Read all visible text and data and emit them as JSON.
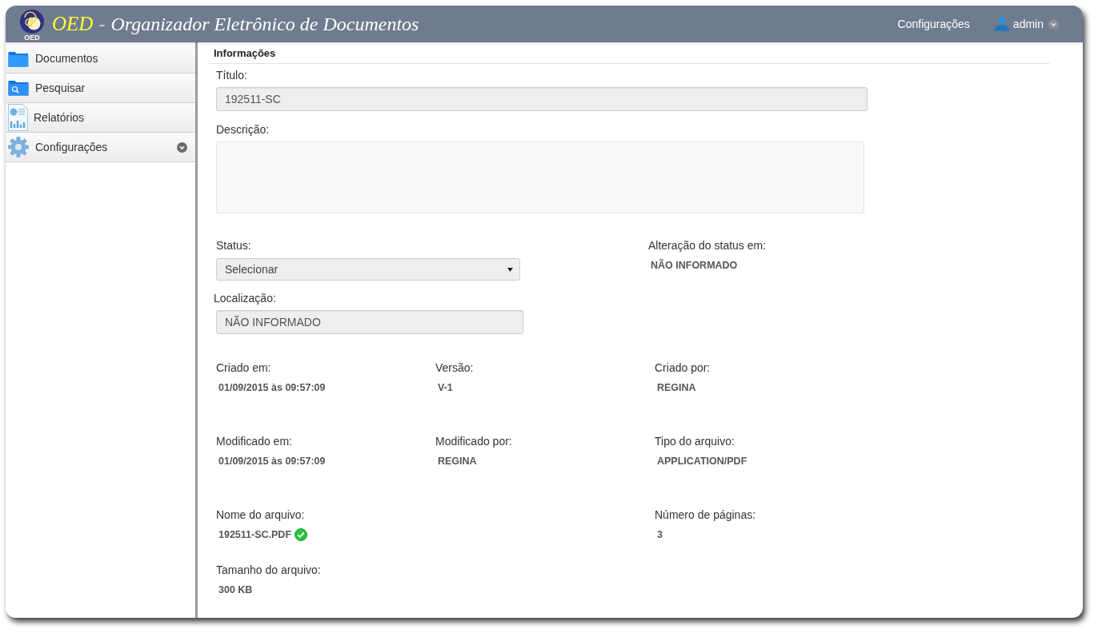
{
  "header": {
    "logo": {
      "text": "OED"
    },
    "abbreviation": "OED",
    "separator": "-",
    "title": "Organizador Eletrônico de Documentos",
    "links": [
      {
        "label": "Configurações"
      }
    ],
    "user": {
      "name": "admin"
    }
  },
  "sidebar": {
    "items": [
      {
        "label": "Documentos",
        "kind": "link",
        "selected": false
      },
      {
        "label": "Pesquisar",
        "kind": "link",
        "selected": false
      },
      {
        "label": "Relatórios",
        "kind": "link",
        "selected": false
      },
      {
        "label": "Configurações",
        "kind": "submenu",
        "selected": false
      }
    ]
  },
  "section": {
    "title": "Informações"
  },
  "form": {
    "title_field": {
      "label": "Título:",
      "value": "192511-SC",
      "disabled": true
    },
    "description_field": {
      "label": "Descrição:"
    },
    "status_field": {
      "label": "Status:",
      "value": "Selecionar",
      "disabled": true
    },
    "status_changed": {
      "label": "Alteração do status em:",
      "value": "NÃO INFORMADO"
    },
    "location_field": {
      "label": "Localização:",
      "value": "NÃO INFORMADO",
      "disabled": true
    }
  },
  "details": [
    {
      "left": {
        "label": "Criado em:",
        "value": "01/09/2015 às 09:57:09"
      },
      "middle": {
        "label": "Versão:",
        "value": "V-1"
      },
      "right": {
        "label": "Criado por:",
        "value": "REGINA"
      }
    },
    {
      "left": {
        "label": "Modificado em:",
        "value": "01/09/2015 às 09:57:09"
      },
      "middle": {
        "label": "Modificado por:",
        "value": "REGINA"
      },
      "right": {
        "label": "Tipo do arquivo:",
        "value": "APPLICATION/PDF"
      }
    },
    {
      "left": {
        "label": "Nome do arquivo:",
        "value": "192511-SC.PDF",
        "verified": true
      },
      "right": {
        "label": "Número de páginas:",
        "value": "3"
      }
    },
    {
      "left": {
        "label": "Tamanho do arquivo:",
        "value": "300 KB"
      }
    }
  ]
}
